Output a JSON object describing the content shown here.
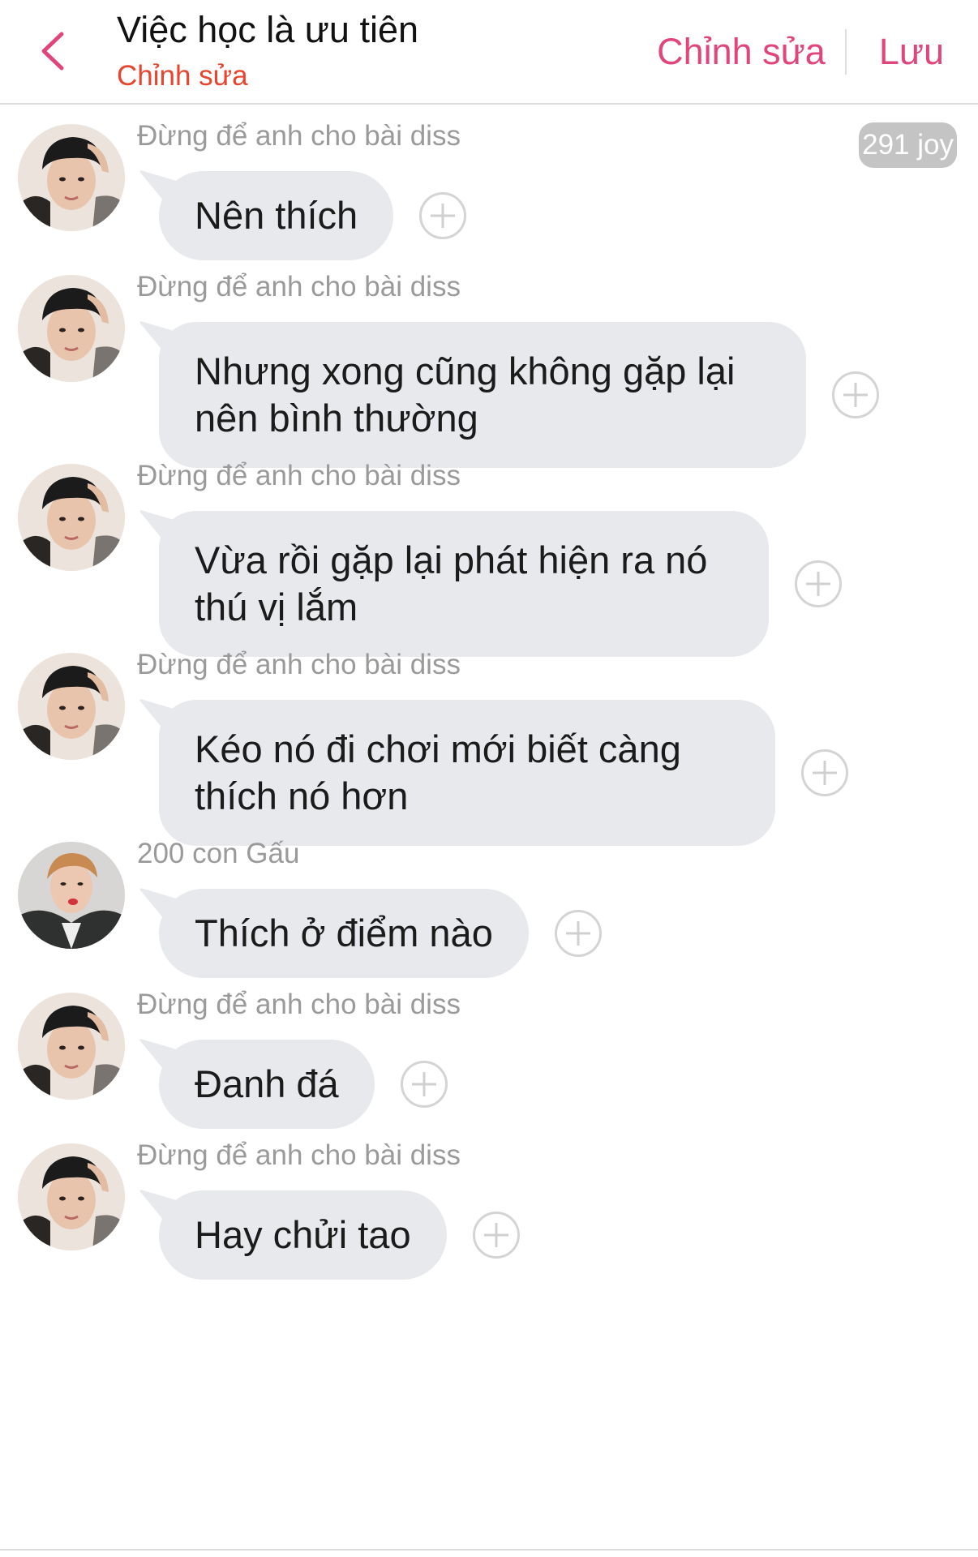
{
  "header": {
    "title": "Việc học là ưu tiên",
    "subtitle": "Chỉnh sửa",
    "edit_label": "Chỉnh sửa",
    "save_label": "Lưu",
    "back_icon": "chevron-left-icon",
    "accent_color": "#e0457d",
    "subtitle_color": "#e8442e"
  },
  "joy_badge": "291 joy",
  "messages": [
    {
      "sender": "Đừng để anh cho bài diss",
      "avatar": "boy-avatar",
      "text": "Nên thích"
    },
    {
      "sender": "Đừng để anh cho bài diss",
      "avatar": "boy-avatar",
      "text": "Nhưng xong cũng không gặp lại nên bình thường"
    },
    {
      "sender": "Đừng để anh cho bài diss",
      "avatar": "boy-avatar",
      "text": "Vừa rồi gặp lại phát hiện ra nó thú vị lắm"
    },
    {
      "sender": "Đừng để anh cho bài diss",
      "avatar": "boy-avatar",
      "text": "Kéo nó đi chơi mới biết càng thích nó hơn"
    },
    {
      "sender": "200 con Gấu",
      "avatar": "girl-avatar",
      "text": "Thích ở điểm nào"
    },
    {
      "sender": "Đừng để anh cho bài diss",
      "avatar": "boy-avatar",
      "text": "Đanh đá"
    },
    {
      "sender": "Đừng để anh cho bài diss",
      "avatar": "boy-avatar",
      "text": "Hay chửi tao"
    }
  ],
  "colors": {
    "bubble": "#e7e9ec",
    "sender_text": "#9a9a9a",
    "add_icon": "#d0d0d0"
  }
}
